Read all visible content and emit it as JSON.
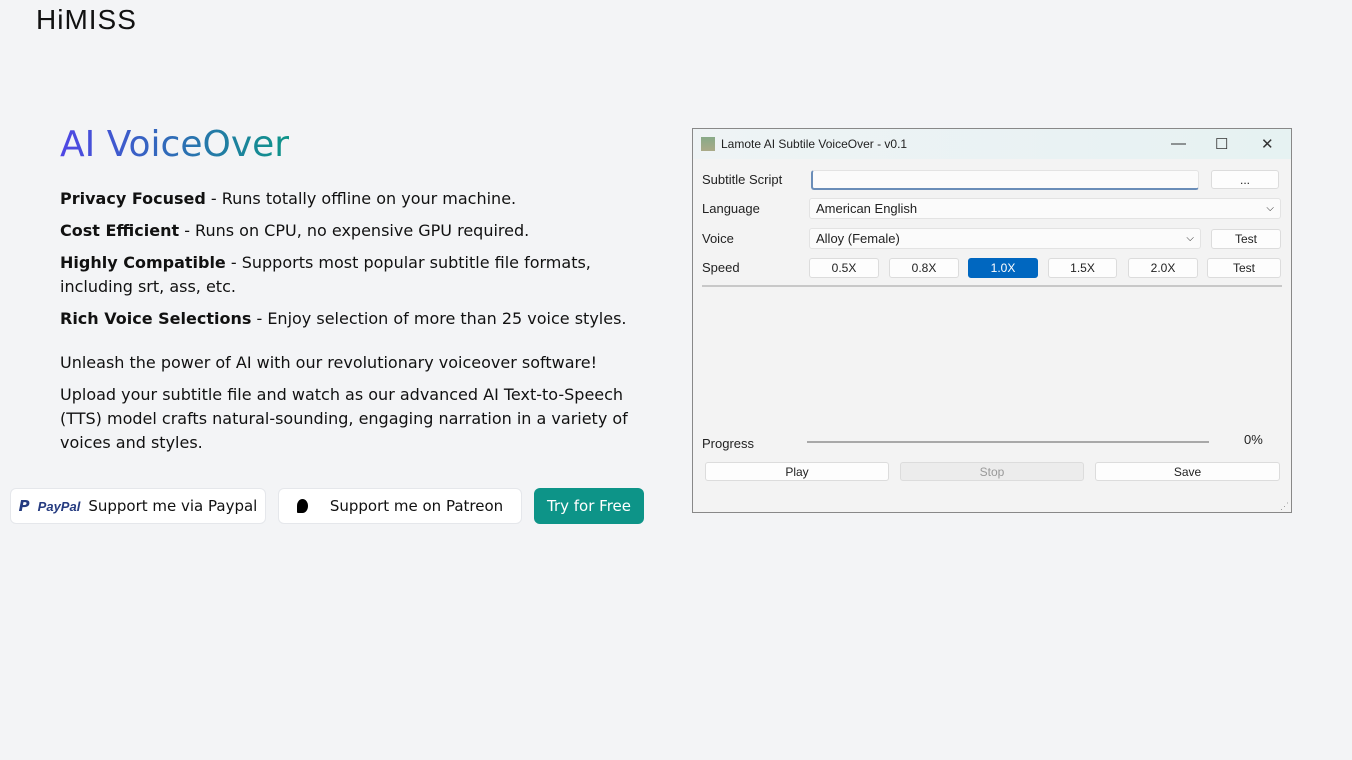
{
  "logo": "HiMISS",
  "hero": {
    "title": "AI VoiceOver",
    "features": [
      {
        "bold": "Privacy Focused",
        "text": " - Runs totally offline on your machine."
      },
      {
        "bold": "Cost Efficient",
        "text": " - Runs on CPU, no expensive GPU required."
      },
      {
        "bold": "Highly Compatible",
        "text": " - Supports most popular subtitle file formats, including srt, ass, etc."
      },
      {
        "bold": "Rich Voice Selections",
        "text": " - Enjoy selection of more than 25 voice styles."
      }
    ],
    "p1": "Unleash the power of AI with our revolutionary voiceover software!",
    "p2": "Upload your subtitle file and watch as our advanced AI Text-to-Speech (TTS) model crafts natural-sounding, engaging narration in a variety of voices and styles."
  },
  "buttons": {
    "paypal_logo": "PayPal",
    "paypal": "Support me via Paypal",
    "patreon": "Support me on Patreon",
    "try": "Try for Free"
  },
  "app": {
    "title": "Lamote AI Subtile VoiceOver - v0.1",
    "subtitle_label": "Subtitle Script",
    "subtitle_value": "",
    "browse": "...",
    "language_label": "Language",
    "language": "American English",
    "voice_label": "Voice",
    "voice": "Alloy (Female)",
    "test": "Test",
    "speed_label": "Speed",
    "speeds": [
      "0.5X",
      "0.8X",
      "1.0X",
      "1.5X",
      "2.0X"
    ],
    "selected_speed": "1.0X",
    "progress_label": "Progress",
    "progress": "0%",
    "play": "Play",
    "stop": "Stop",
    "save": "Save"
  }
}
